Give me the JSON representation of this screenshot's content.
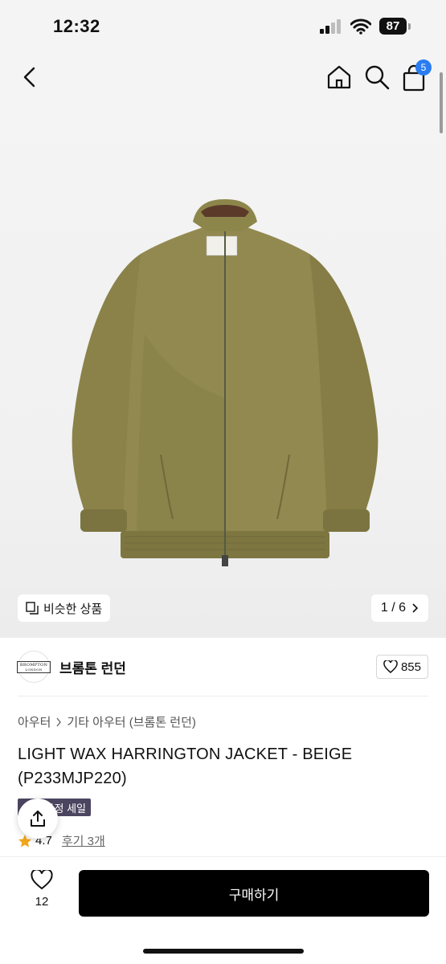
{
  "status_bar": {
    "time": "12:32",
    "battery": "87"
  },
  "nav": {
    "cart_count": "5"
  },
  "gallery": {
    "similar_label": "비슷한 상품",
    "pager": "1 / 6"
  },
  "brand": {
    "name": "브롬톤 런던",
    "logo_text": "BROMPTON",
    "logo_subtext": "LONDON",
    "like_count": "855"
  },
  "breadcrumb": {
    "level1": "아우터",
    "level2": "기타 아우터 (브롬톤 런던)"
  },
  "product": {
    "title": "LIGHT WAX HARRINGTON JACKET - BEIGE (P233MJP220)",
    "sale_badge": "시즌 한정 세일",
    "rating": "4.7",
    "review_label": "후기 3개"
  },
  "bottom_bar": {
    "wish_count": "12",
    "buy_label": "구매하기"
  },
  "colors": {
    "accent_blue": "#2a7cf0",
    "badge_purple": "#4c4560",
    "buy_button": "#000000",
    "star": "#f2a71b"
  }
}
